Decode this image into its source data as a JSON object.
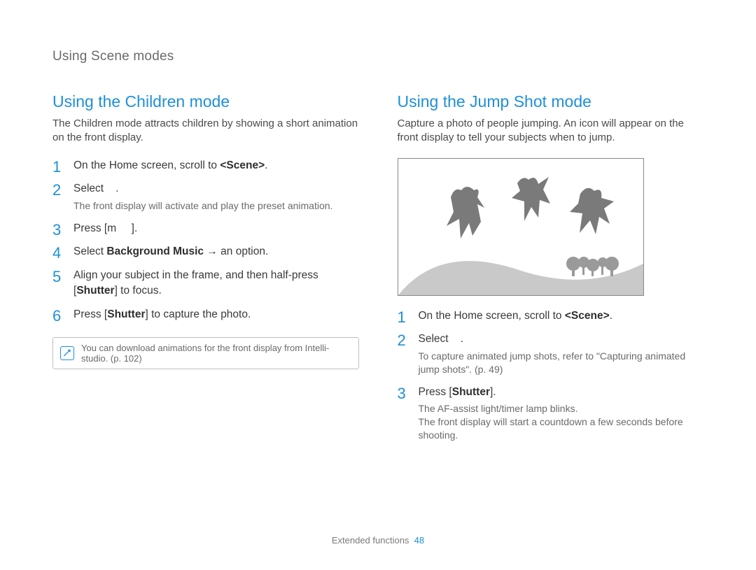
{
  "section_title": "Using Scene modes",
  "left": {
    "heading": "Using the Children mode",
    "intro": "The Children mode attracts children by showing a short animation on the front display.",
    "steps": [
      {
        "html": "On the Home screen, scroll to <b>&lt;Scene&gt;</b>."
      },
      {
        "html": "Select&nbsp;&nbsp;&nbsp;&nbsp;.",
        "sub": "The front display will activate and play the preset animation."
      },
      {
        "html": "Press [m&nbsp;&nbsp;&nbsp;&nbsp;&nbsp;]."
      },
      {
        "html": "Select <b>Background Music</b> → an option."
      },
      {
        "html": "Align your subject in the frame, and then half-press [<b>Shutter</b>] to focus."
      },
      {
        "html": "Press [<b>Shutter</b>] to capture the photo."
      }
    ],
    "note": "You can download animations for the front display from Intelli-studio. (p. 102)"
  },
  "right": {
    "heading": "Using the Jump Shot mode",
    "intro": "Capture a photo of people jumping. An icon will appear on the front display to tell your subjects when to jump.",
    "steps": [
      {
        "html": "On the Home screen, scroll to <b>&lt;Scene&gt;</b>."
      },
      {
        "html": "Select&nbsp;&nbsp;&nbsp;&nbsp;.",
        "sub": "To capture animated jump shots, refer to \"Capturing animated jump shots\". (p. 49)"
      },
      {
        "html": "Press [<b>Shutter</b>].",
        "sub": "The AF-assist light/timer lamp blinks.<br>The front display will start a countdown a few seconds before shooting."
      }
    ]
  },
  "footer": {
    "label": "Extended functions",
    "page": "48"
  }
}
